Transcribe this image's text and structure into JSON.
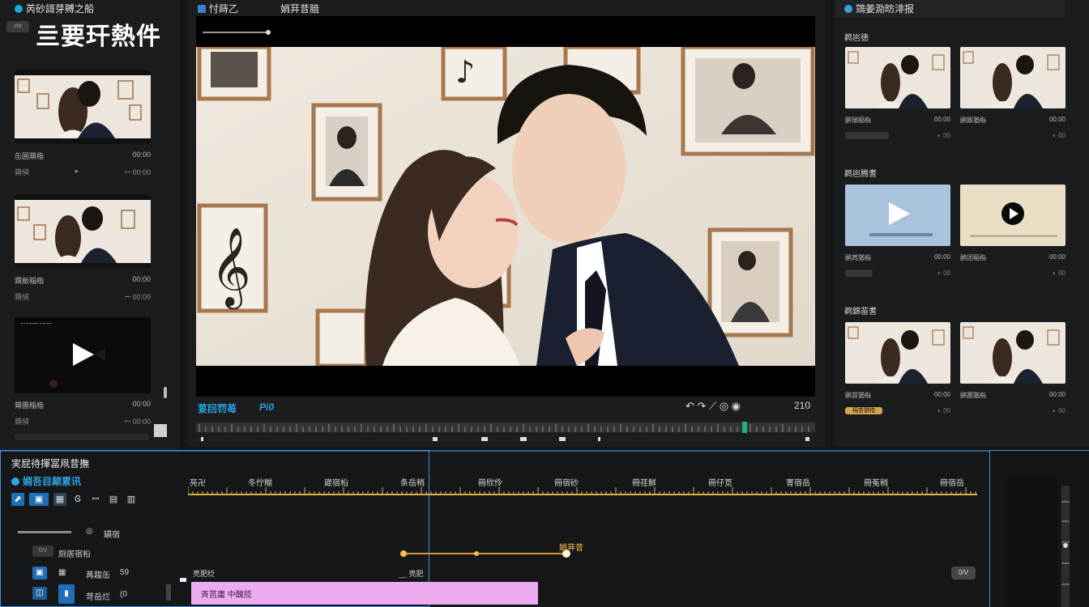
{
  "left_panel": {
    "window_title": "芮砂謌芽賻之船",
    "chip": "cht",
    "big_title": "亖要玕熱件",
    "cards": [
      {
        "title": "缶囲蒴栺",
        "meta": "00:00",
        "sub": "蒴偵",
        "mark": "▸",
        "sub_right": "ꟷ 00:00"
      },
      {
        "title": "蒴飯稲栺",
        "meta": "00:00",
        "sub": "蒴偵",
        "mark": "",
        "sub_right": "ꟷ 00:00"
      },
      {
        "title": "蒴團稲栺",
        "meta": "00:00",
        "sub": "蒴偵",
        "mark": "",
        "sub_right": "ꟷ 00:00",
        "is_video": true,
        "video_caption": "ꟷ ꟷꟷꟷ ꟷꟷꟷ"
      }
    ]
  },
  "center": {
    "tab1": "忖蒔乙",
    "tab2": "娋荓昔腤",
    "ctrl_label": "荽囙罚苺",
    "ctrl_counter": "Pi0",
    "ctrl_time": "210",
    "ctrl_icons": "↶ ↷   ⟋ ◎ ◉"
  },
  "right_panel": {
    "title": "鵍姜泐昉渄报",
    "sections": [
      {
        "label": "鹈岜徳",
        "cards": [
          {
            "title": "鹂瑞稲栺",
            "meta": "00:00",
            "kind": "photo"
          },
          {
            "title": "鹂飯猶栺",
            "meta": "00:00",
            "kind": "photo"
          }
        ]
      },
      {
        "label": "鹈岜腾耆",
        "cards": [
          {
            "title": "鹂茼猶栺",
            "meta": "00:00",
            "kind": "blue-video"
          },
          {
            "title": "鹂团稲栺",
            "meta": "00:00",
            "kind": "beige-video"
          }
        ]
      },
      {
        "label": "鹈錦苗耆",
        "cards": [
          {
            "title": "鹂苗猶栺",
            "meta": "00:00",
            "kind": "photo",
            "badge": "稲苗猶栺"
          },
          {
            "title": "鹂團猶栺",
            "meta": "00:00",
            "kind": "photo"
          }
        ]
      }
    ]
  },
  "timeline": {
    "title": "実屁待揮冨凧昔撫",
    "subtitle": "婣吾目颠累讯",
    "tools": [
      "⬈",
      "▣",
      "▦",
      "Ꮆ",
      "ꟷ",
      "▤",
      "▥"
    ],
    "slider_label": "罆宿",
    "chip": "0/V",
    "row1_label": "厕居宿柗",
    "row2_label": "苒趨缶",
    "row2_value": "59",
    "row3_label": "苛岳烂",
    "row3_value": "(0",
    "ruler_labels": [
      "亮卍",
      "冬佇糋",
      "崴宿柗",
      "条岳稍",
      "冊欣伶",
      "冊宿砂",
      "冊荏觧",
      "冊仔笕",
      "寈宿岳",
      "冊菟稍",
      "冊宿岳"
    ],
    "keyframe_label": "娋荓昔",
    "clip_label_left": "亮肥柉",
    "clip_label_mid": "__ 亮肥",
    "clip_text": "斉莒庸 中醜揽",
    "toggle": "0/V"
  }
}
